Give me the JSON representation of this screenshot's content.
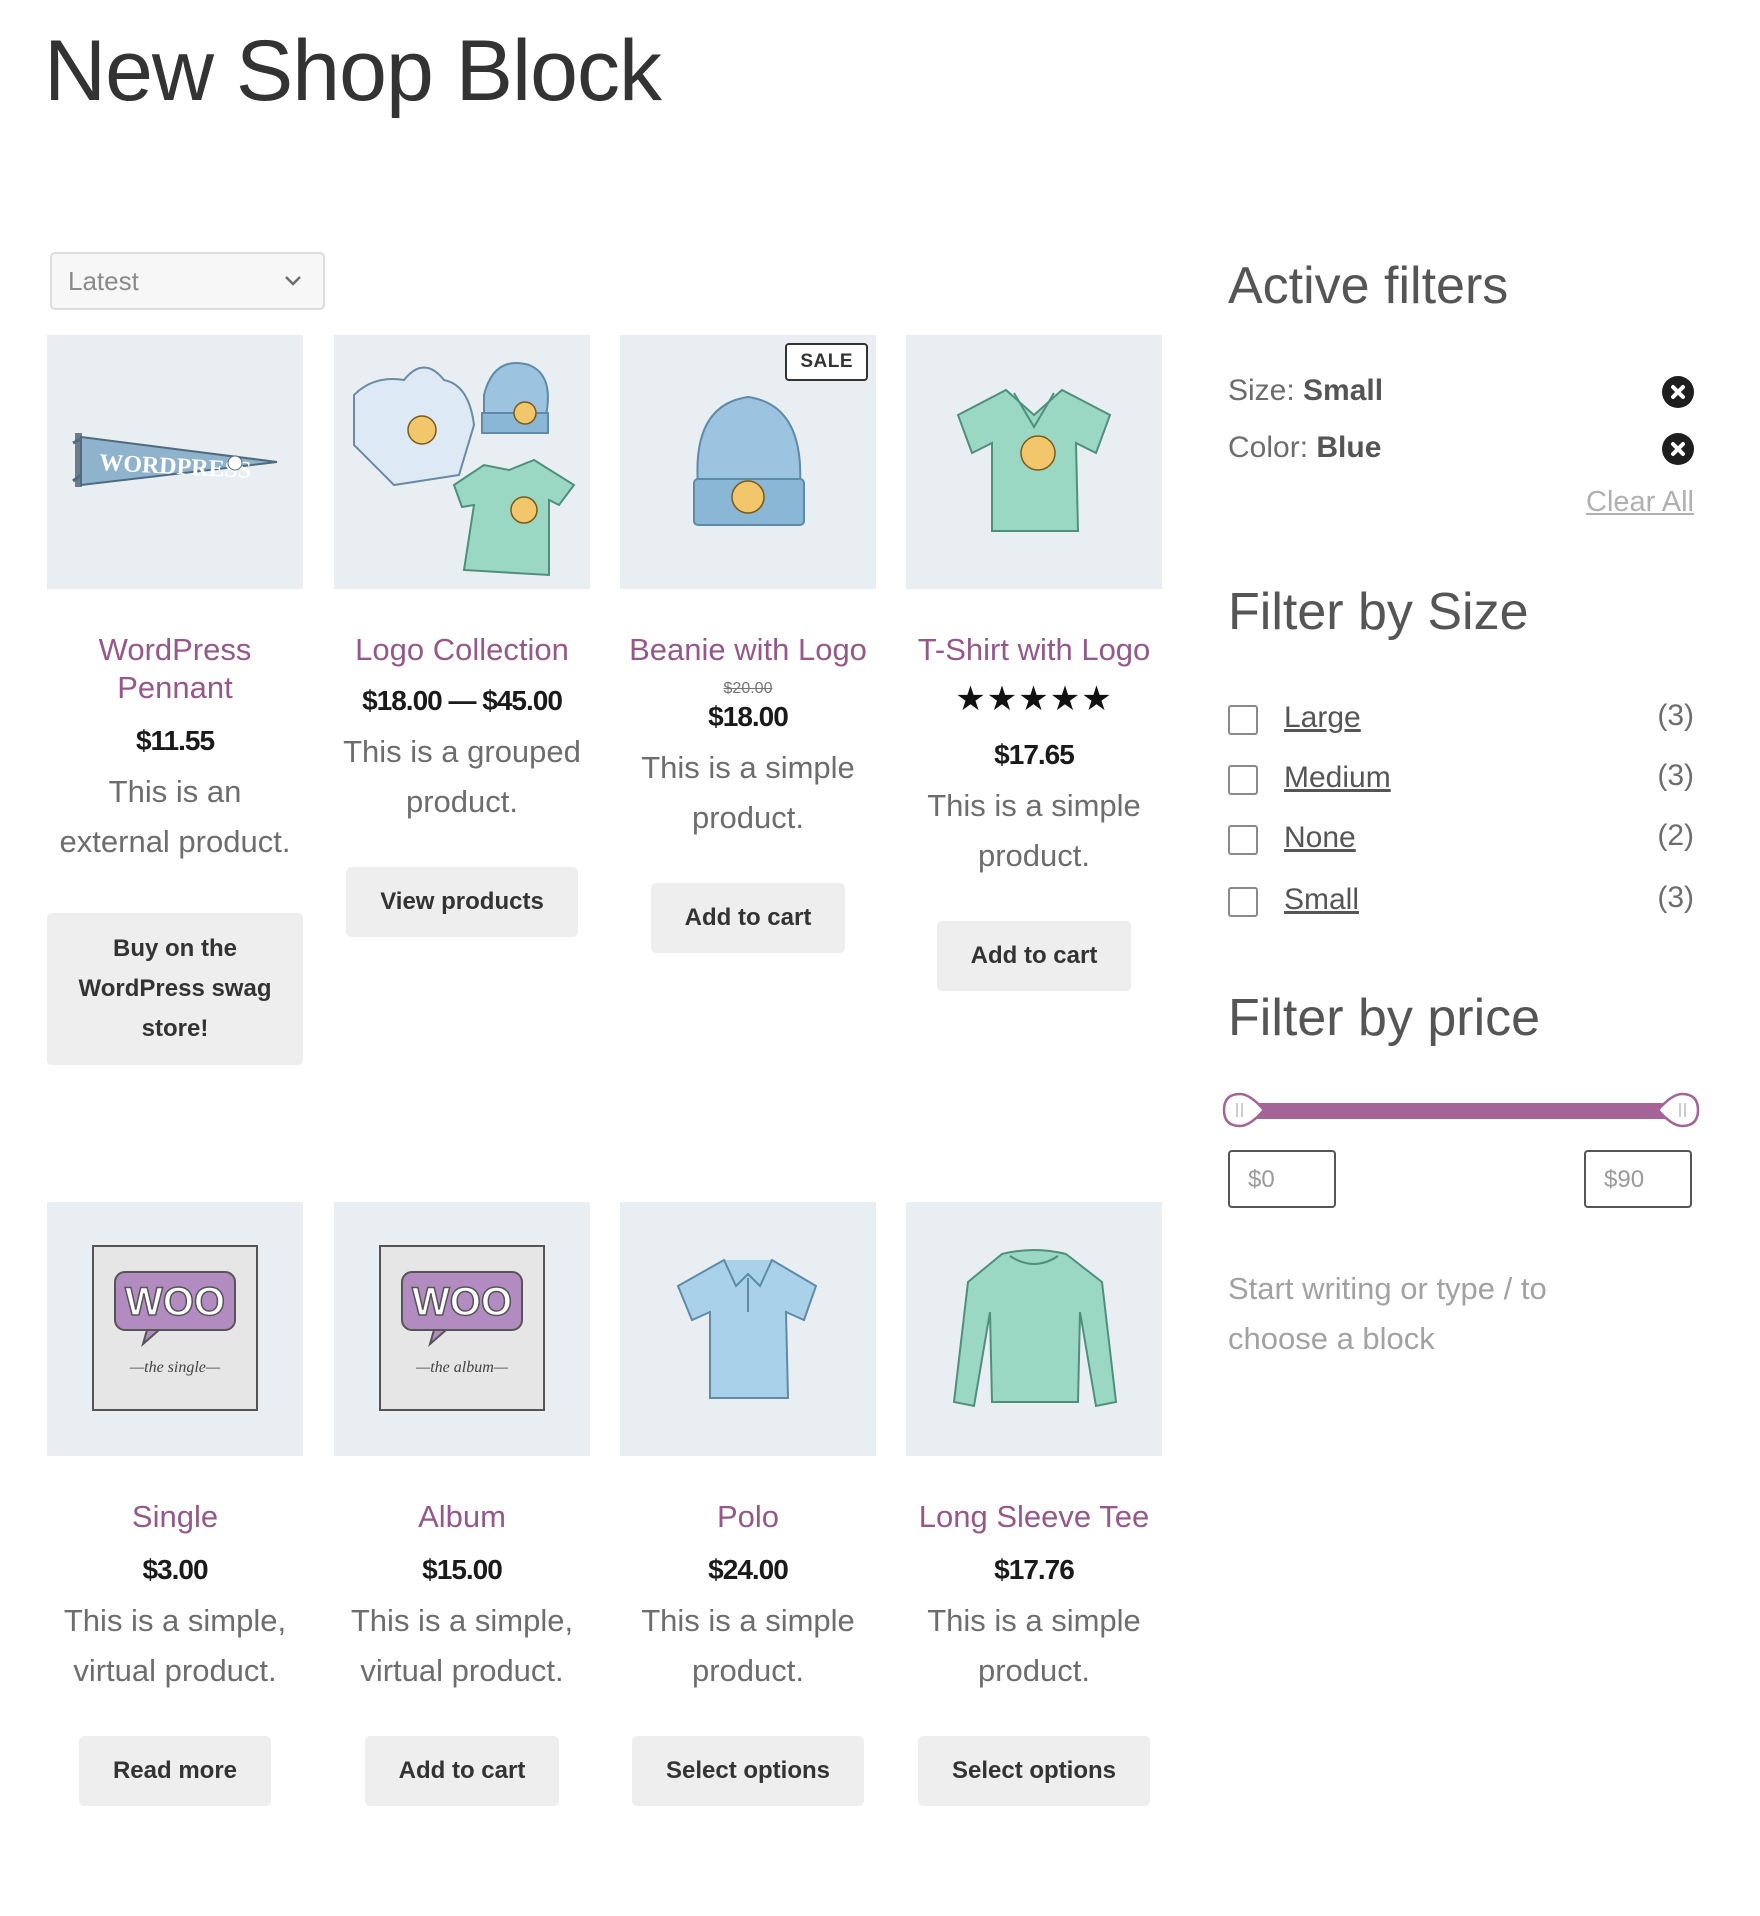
{
  "page": {
    "title": "New Shop Block"
  },
  "sort": {
    "selected": "Latest"
  },
  "products": [
    {
      "title": "WordPress Pennant",
      "price": "$11.55",
      "description": "This is an external product.",
      "button": "Buy on the WordPress swag store!"
    },
    {
      "title": "Logo Collection",
      "price": "$18.00 — $45.00",
      "description": "This is a grouped product.",
      "button": "View products"
    },
    {
      "title": "Beanie with Logo",
      "badge": "SALE",
      "old_price": "$20.00",
      "price": "$18.00",
      "description": "This is a simple product.",
      "button": "Add to cart"
    },
    {
      "title": "T-Shirt with Logo",
      "rating": 5,
      "rating_stars": "★★★★★",
      "price": "$17.65",
      "description": "This is a simple product.",
      "button": "Add to cart"
    },
    {
      "title": "Single",
      "price": "$3.00",
      "description": "This is a simple, virtual product.",
      "button": "Read more"
    },
    {
      "title": "Album",
      "price": "$15.00",
      "description": "This is a simple, virtual product.",
      "button": "Add to cart"
    },
    {
      "title": "Polo",
      "price": "$24.00",
      "description": "This is a simple product.",
      "button": "Select options"
    },
    {
      "title": "Long Sleeve Tee",
      "price": "$17.76",
      "description": "This is a simple product.",
      "button": "Select options"
    }
  ],
  "active_filters": {
    "heading": "Active filters",
    "items": [
      {
        "label": "Size:",
        "value": "Small"
      },
      {
        "label": "Color:",
        "value": "Blue"
      }
    ],
    "clear_all": "Clear All"
  },
  "filter_size": {
    "heading": "Filter by Size",
    "options": [
      {
        "label": "Large",
        "count": "(3)",
        "checked": false
      },
      {
        "label": "Medium",
        "count": "(3)",
        "checked": false
      },
      {
        "label": "None",
        "count": "(2)",
        "checked": false
      },
      {
        "label": "Small",
        "count": "(3)",
        "checked": false
      }
    ]
  },
  "filter_price": {
    "heading": "Filter by price",
    "min_placeholder": "$0",
    "max_placeholder": "$90"
  },
  "editor_hint": "Start writing or type / to choose a block",
  "colors": {
    "accent": "#96588a",
    "slider": "#a46497",
    "thumb_bg": "#e9eef3"
  }
}
